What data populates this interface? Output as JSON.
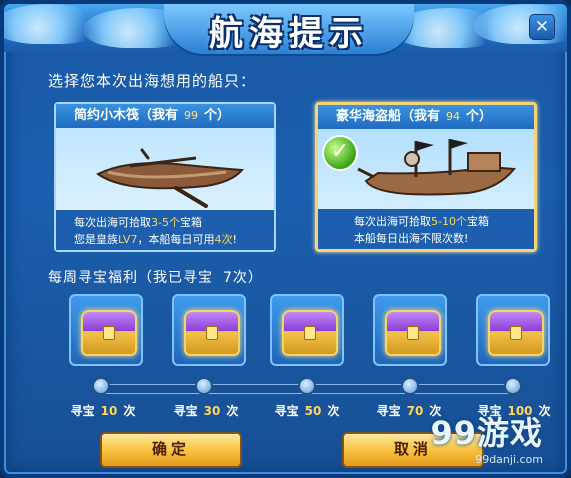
{
  "dialog": {
    "title": "航海提示",
    "close_label": "✕",
    "prompt": "选择您本次出海想用的船只："
  },
  "ships": [
    {
      "name": "简约小木筏（我有",
      "count": "99",
      "unit": "个）",
      "desc1_pre": "每次出海可拾取",
      "desc1_hl": "3-5个",
      "desc1_post": "宝箱",
      "desc2_pre": "您是皇族",
      "desc2_hl": "LV7",
      "desc2_mid": "，本船每日可用",
      "desc2_hl2": "4次",
      "desc2_post": "!",
      "selected": false
    },
    {
      "name": "豪华海盗船（我有",
      "count": "94",
      "unit": "个）",
      "desc1_pre": "每次出海可拾取",
      "desc1_hl": "5-10个",
      "desc1_post": "宝箱",
      "desc2_text": "本船每日出海不限次数!",
      "selected": true
    }
  ],
  "weekly": {
    "label": "每周寻宝福利（我已寻宝",
    "count": "7",
    "unit": "次）"
  },
  "rewards": [
    {
      "prefix": "寻宝",
      "value": "10",
      "suffix": "次"
    },
    {
      "prefix": "寻宝",
      "value": "30",
      "suffix": "次"
    },
    {
      "prefix": "寻宝",
      "value": "50",
      "suffix": "次"
    },
    {
      "prefix": "寻宝",
      "value": "70",
      "suffix": "次"
    },
    {
      "prefix": "寻宝",
      "value": "100",
      "suffix": "次"
    }
  ],
  "buttons": {
    "confirm": "确定",
    "cancel": "取消"
  },
  "watermark": {
    "logo": "99游戏",
    "site": "99danji.com"
  },
  "icons": {
    "close": "close-icon",
    "check": "checkmark-icon",
    "chest": "treasure-chest-icon",
    "boat": "rowboat-icon",
    "ship": "pirate-ship-icon"
  },
  "colors": {
    "highlight": "#ffd65a",
    "panel": "#1b5fae",
    "button": "#f7bf3c"
  }
}
